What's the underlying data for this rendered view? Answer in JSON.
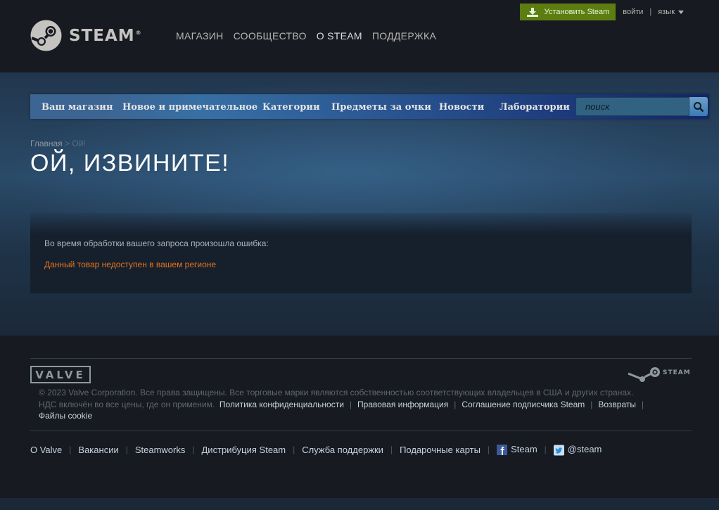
{
  "header": {
    "logo_text": "STEAM",
    "logo_reg": "®",
    "nav": [
      "МАГАЗИН",
      "СООБЩЕСТВО",
      "О STEAM",
      "ПОДДЕРЖКА"
    ],
    "install_label": "Установить Steam",
    "login_label": "войти",
    "separator": "|",
    "language_label": "язык"
  },
  "store_nav": {
    "tabs": [
      "Ваш магазин",
      "Новое и примечательное",
      "Категории",
      "Предметы за очки",
      "Новости",
      "Лаборатории"
    ],
    "search_placeholder": "поиск"
  },
  "breadcrumb": {
    "home": "Главная",
    "separator": ">",
    "current": "Ой!"
  },
  "page_title": "ОЙ, ИЗВИНИТЕ!",
  "error": {
    "intro": "Во время обработки вашего запроса произошла ошибка:",
    "message": "Данный товар недоступен в вашем регионе"
  },
  "footer": {
    "valve_logo": "VALVE",
    "steam_logo": "STEAM",
    "copyright": "© 2023 Valve Corporation. Все права защищены. Все торговые марки являются собственностью соответствующих владельцев в США и других странах.",
    "vat_note": "НДС включён во все цены, где он применим.",
    "legal_links": [
      "Политика конфиденциальности",
      "Правовая информация",
      "Соглашение подписчика Steam",
      "Возвраты",
      "Файлы cookie"
    ],
    "links": [
      "О Valve",
      "Вакансии",
      "Steamworks",
      "Дистрибуция Steam",
      "Служба поддержки",
      "Подарочные карты"
    ],
    "facebook_label": "Steam",
    "twitter_label": "@steam",
    "link_separator": "|"
  },
  "colors": {
    "header_bg": "#171a21",
    "install_green": "#5c7e10",
    "error_orange": "#e7731b",
    "page_bg": "#1b2838"
  }
}
